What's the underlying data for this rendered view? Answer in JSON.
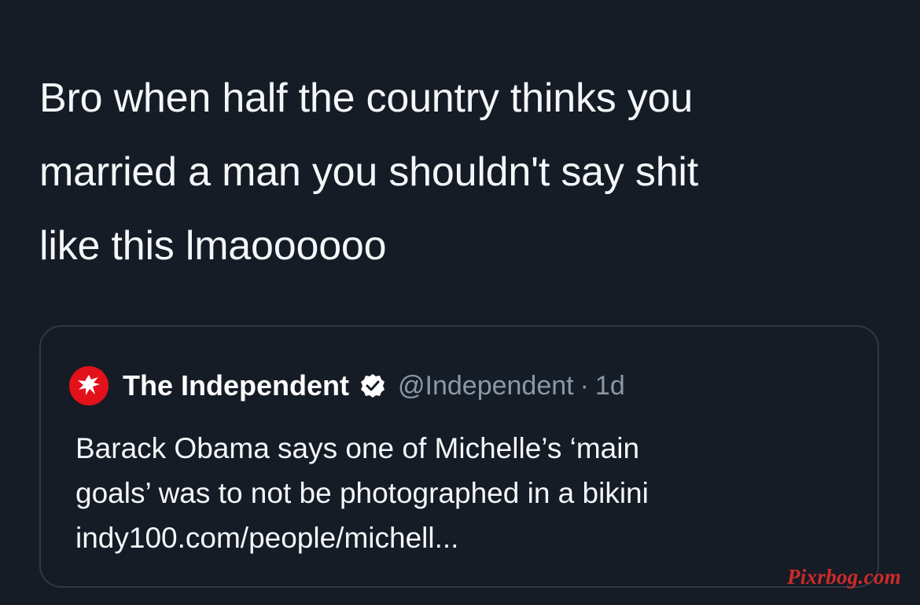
{
  "tweet": {
    "text": "Bro when half the country thinks you\nmarried a man you shouldn't say shit\nlike this lmaoooooo"
  },
  "quote": {
    "avatar_icon": "independent-eagle-logo-icon",
    "display_name": "The Independent",
    "verified_icon": "verified-badge-icon",
    "handle": "@Independent",
    "separator": "·",
    "time": "1d",
    "body": "Barack Obama says one of Michelle’s ‘main\ngoals’ was to not be photographed in a bikini\nindy100.com/people/michell..."
  },
  "watermark": {
    "text": "Pixrbog.com"
  },
  "colors": {
    "background": "#161c26",
    "primary_text": "#f4f6f8",
    "secondary_text": "#8b98a5",
    "border": "#2f3944",
    "avatar_red": "#e3111a",
    "watermark_red": "#cf2a2a"
  }
}
